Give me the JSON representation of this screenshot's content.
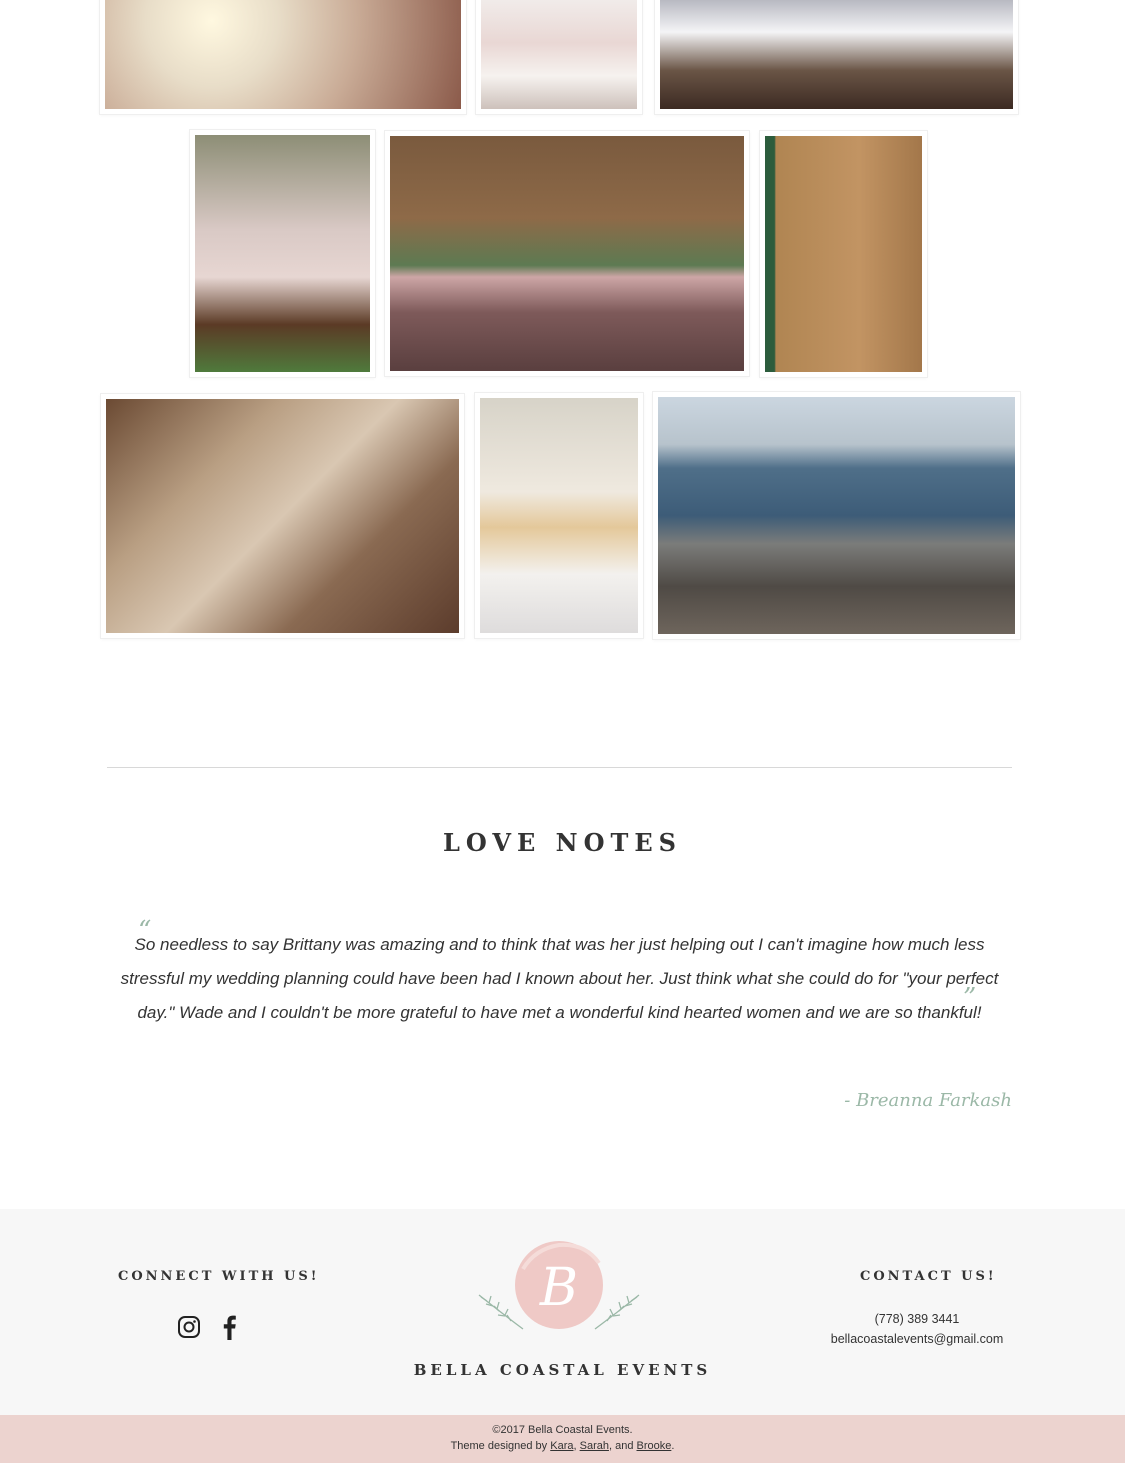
{
  "gallery": {
    "photos": [
      {
        "name": "fairy-lights-photo",
        "alt": "fairy lights"
      },
      {
        "name": "place-setting-photo",
        "alt": "place setting"
      },
      {
        "name": "reception-hall-photo",
        "alt": "reception hall tables"
      },
      {
        "name": "mr-mrs-chairs-photo",
        "alt": "Mr and Mrs chairs"
      },
      {
        "name": "flower-centerpiece-photo",
        "alt": "flower centerpiece"
      },
      {
        "name": "decor-ladder-photo",
        "alt": "decorative ladder"
      },
      {
        "name": "mr-mrs-sign-photo",
        "alt": "Mr & Mrs sign"
      },
      {
        "name": "naked-cake-photo",
        "alt": "wedding cake"
      },
      {
        "name": "beach-ladder-photo",
        "alt": "beach ladder with fabric"
      }
    ]
  },
  "love_notes": {
    "title": "LOVE NOTES",
    "quote": "So needless to say Brittany was amazing and to think that was her just helping out I can't imagine how much less stressful my wedding planning could have been had I known about her. Just think what she could do for \"your perfect day.\" Wade and I couldn't be more grateful to have met a wonderful kind hearted women and we are so thankful!",
    "open_mark": "“",
    "close_mark": "”",
    "author": "- Breanna Farkash"
  },
  "footer": {
    "connect_title": "CONNECT WITH US!",
    "social_icons": [
      "instagram-icon",
      "facebook-icon"
    ],
    "logo_letter": "B",
    "brand": "BELLA COASTAL EVENTS",
    "contact_title": "CONTACT US!",
    "phone": "(778) 389 3441",
    "email": "bellacoastalevents@gmail.com"
  },
  "bottom_bar": {
    "copyright": "©2017 Bella Coastal Events.",
    "theme_prefix": "Theme designed by ",
    "designer_1": "Kara",
    "sep_1": ", ",
    "designer_2": "Sarah",
    "sep_2": ", and ",
    "designer_3": "Brooke",
    "suffix": "."
  },
  "colors": {
    "accent_sage": "#9bb8a7",
    "blush": "#ecd3cf",
    "logo_pink": "#efc9c6"
  }
}
